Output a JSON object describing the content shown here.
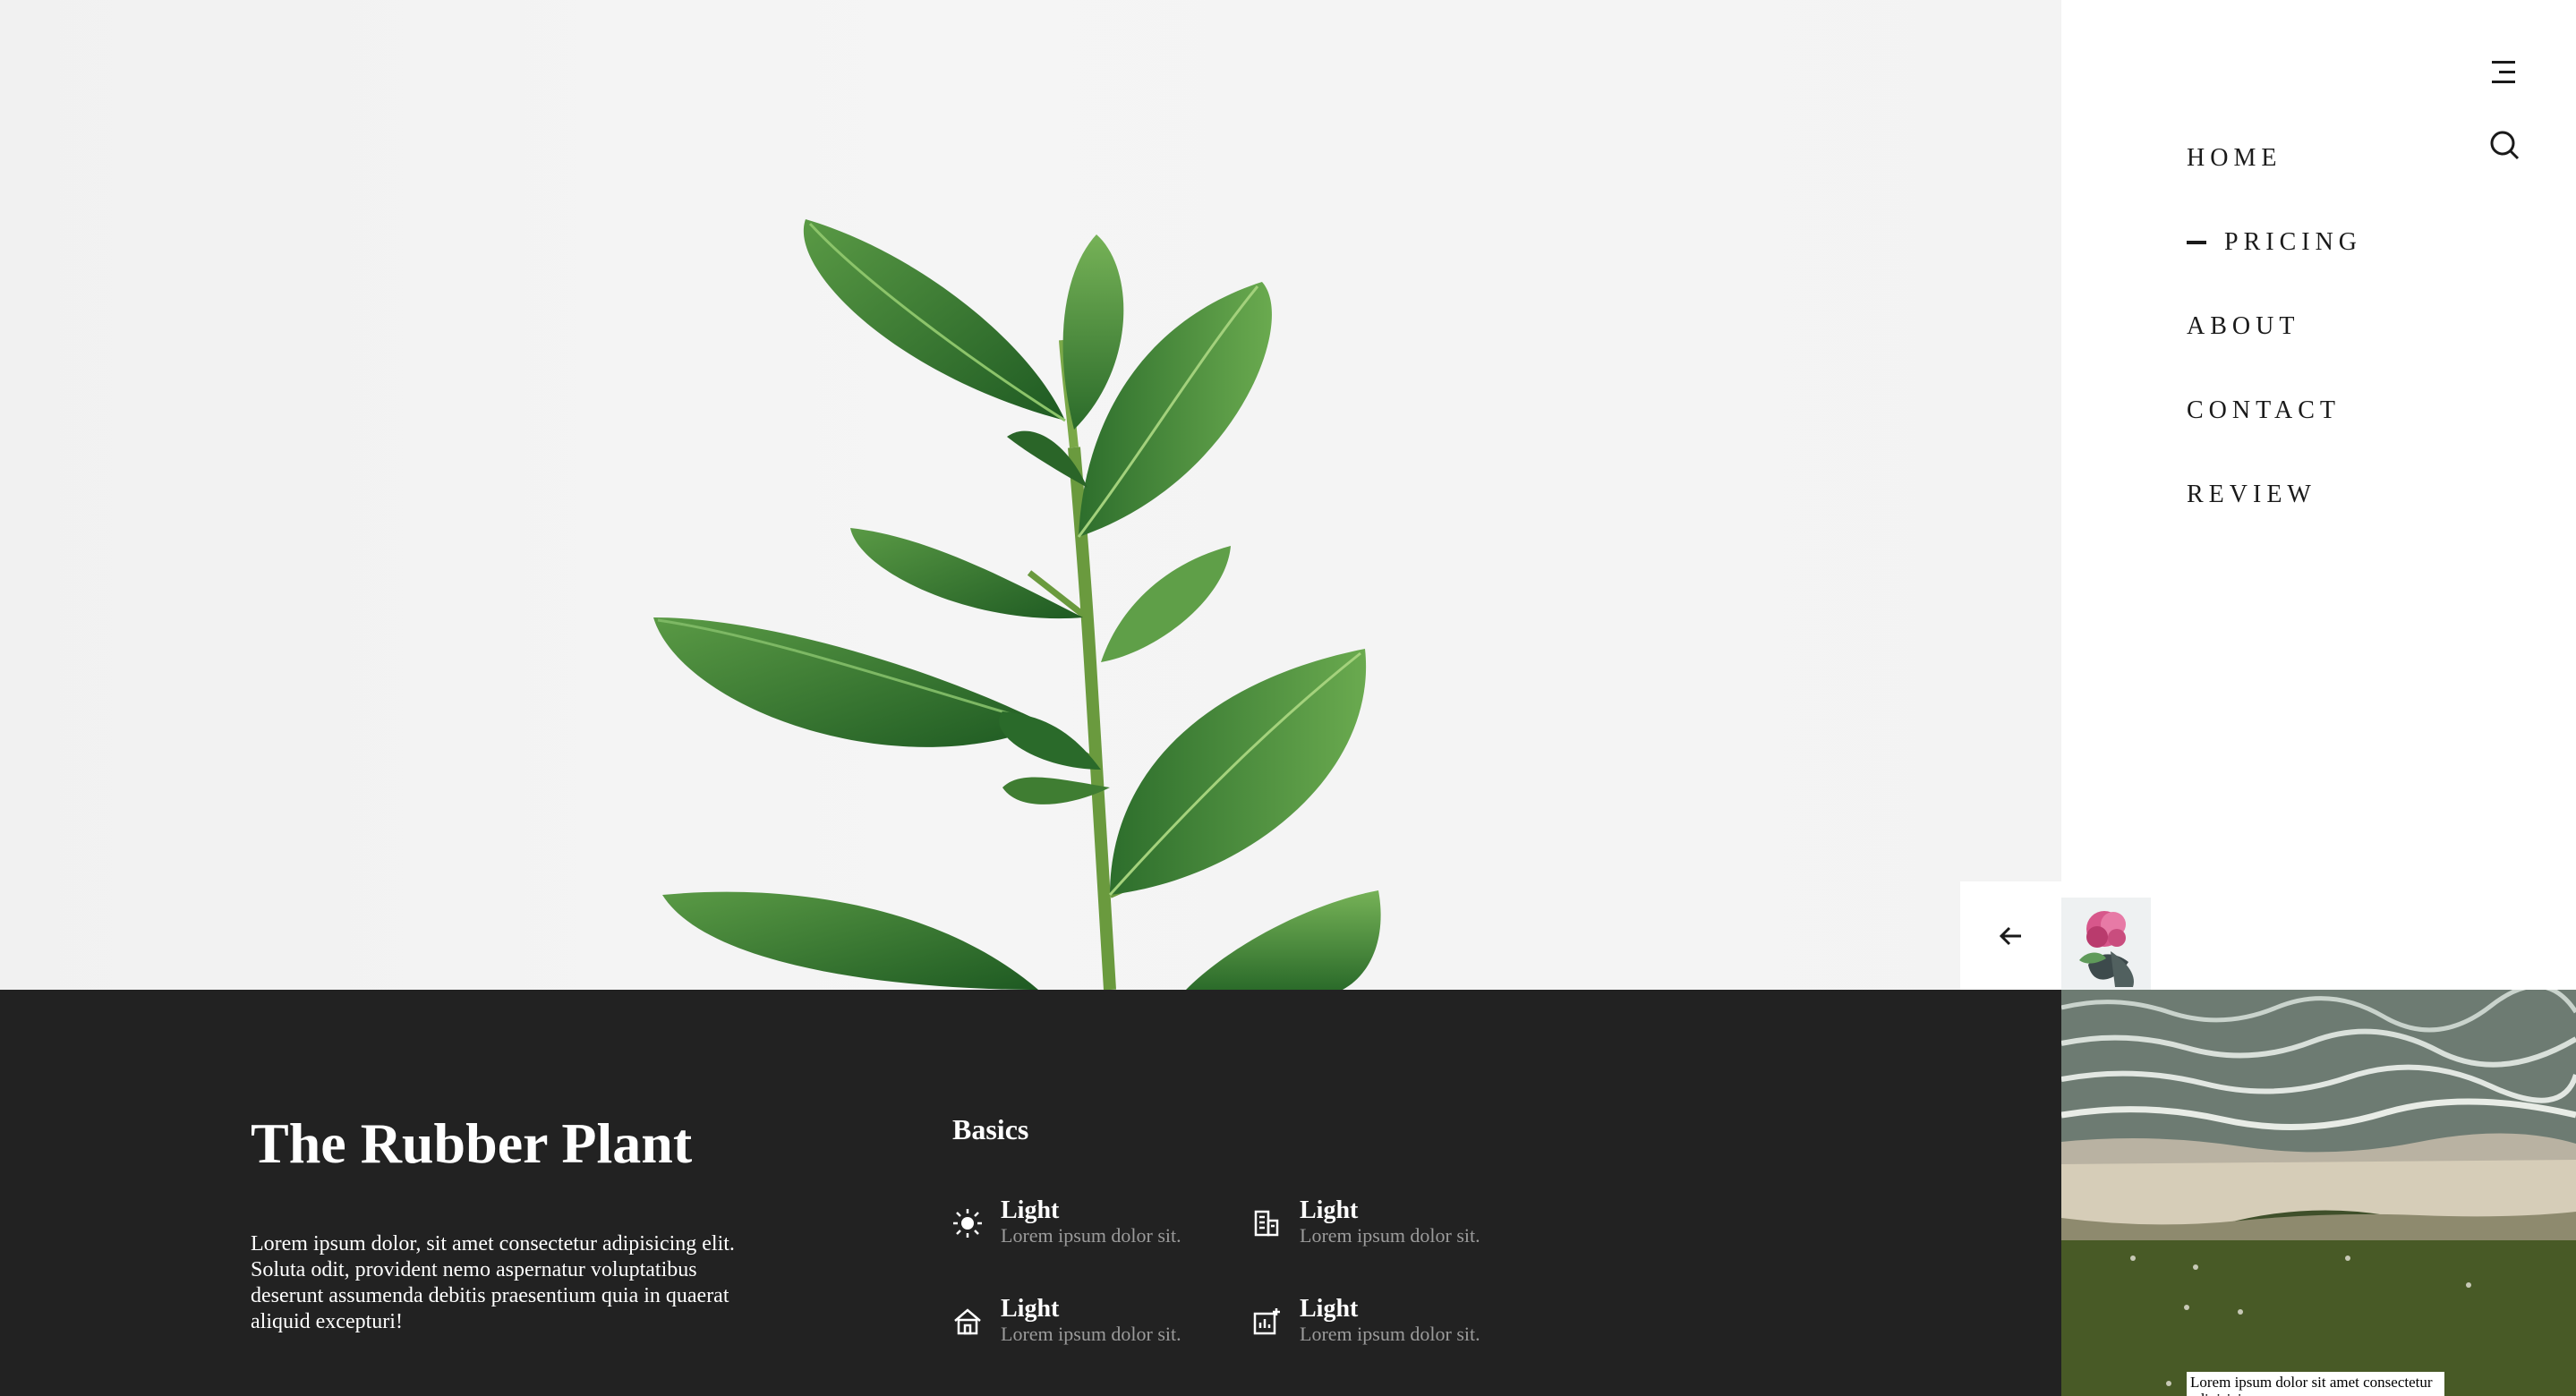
{
  "hero": {
    "image": "rubber-plant-photo"
  },
  "header": {
    "menu_icon": "hamburger-icon",
    "search_icon": "search-icon"
  },
  "nav": {
    "items": [
      {
        "label": "HOME",
        "active": false
      },
      {
        "label": "PRICING",
        "active": true
      },
      {
        "label": "ABOUT",
        "active": false
      },
      {
        "label": "CONTACT",
        "active": false
      },
      {
        "label": "REVIEW",
        "active": false
      }
    ]
  },
  "slider": {
    "prev_icon": "arrow-left-icon",
    "thumbnails": [
      "pink-flower-thumbnail",
      "beach-aerial-thumbnail"
    ],
    "caption": "Lorem ipsum dolor sit amet consectetur adipisicing"
  },
  "info": {
    "title": "The Rubber Plant",
    "description": "Lorem ipsum dolor, sit amet consectetur adipisicing elit. Soluta odit, provident nemo aspernatur voluptatibus deserunt assumenda debitis praesentium quia in quaerat aliquid excepturi!",
    "basics_title": "Basics",
    "features": [
      {
        "icon": "sun-icon",
        "title": "Light",
        "text": "Lorem ipsum dolor sit."
      },
      {
        "icon": "building-icon",
        "title": "Light",
        "text": "Lorem ipsum dolor sit."
      },
      {
        "icon": "home-icon",
        "title": "Light",
        "text": "Lorem ipsum dolor sit."
      },
      {
        "icon": "chart-icon",
        "title": "Light",
        "text": "Lorem ipsum dolor sit."
      }
    ]
  },
  "colors": {
    "panel": "#222222",
    "muted_text": "#9b9b9b",
    "leaf": "#2e7d32"
  }
}
